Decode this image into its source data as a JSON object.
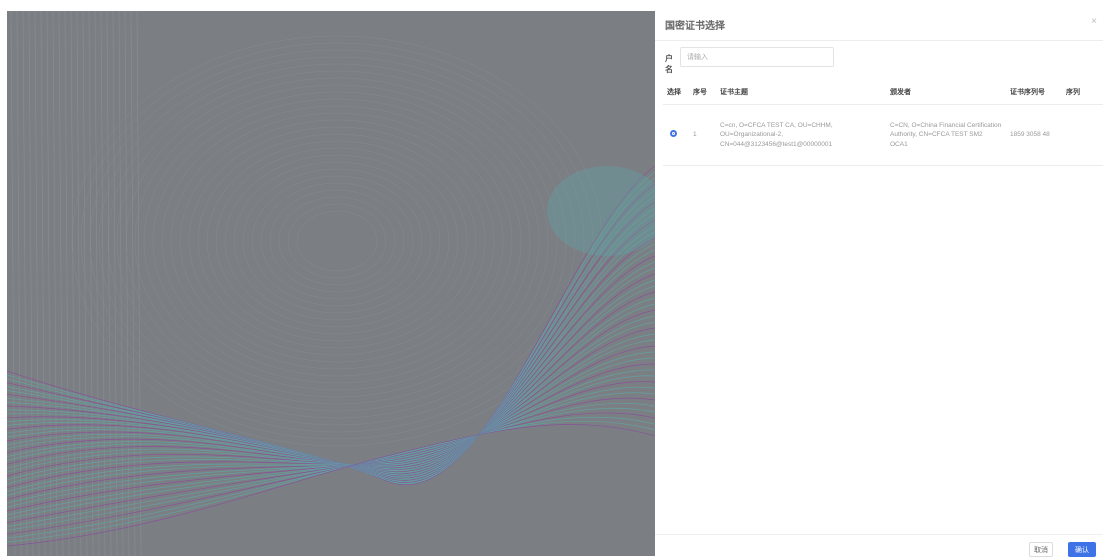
{
  "drawer": {
    "title": "国密证书选择",
    "close_glyph": "×",
    "filter_label": "户名",
    "filter_placeholder": "请输入"
  },
  "table": {
    "columns": [
      "选择",
      "序号",
      "证书主题",
      "颁发者",
      "证书序列号",
      "序列"
    ],
    "rows": [
      {
        "selected": true,
        "index": "1",
        "subject": "C=cn, O=CFCA TEST CA, OU=CHHM, OU=Organizational-2, CN=044@3123456@test1@00000001",
        "issuer": "C=CN, O=China Financial Certification Authority, CN=CFCA TEST SM2 OCA1",
        "serial": "1859 3058 48"
      }
    ]
  },
  "footer": {
    "cancel_label": "取消",
    "confirm_label": "确认"
  },
  "colors": {
    "accent": "#3e73e8",
    "backdrop": "#7b7f84",
    "wave_teal": "#5fa7a5",
    "wave_purple": "#8a4a9c"
  }
}
